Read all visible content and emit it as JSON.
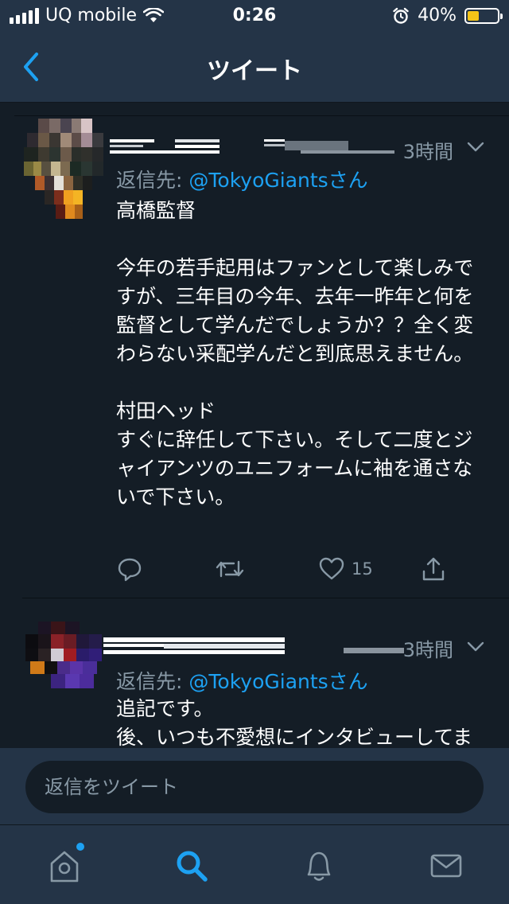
{
  "status_bar": {
    "carrier": "UQ mobile",
    "time": "0:26",
    "battery_percent": "40%",
    "battery_level": 0.4,
    "battery_color": "#f5c518"
  },
  "nav": {
    "title": "ツイート",
    "back_icon": "chevron-left-icon"
  },
  "colors": {
    "background": "#141d26",
    "bar_background": "#243447",
    "accent": "#1da1f2",
    "secondary_text": "#8899a6"
  },
  "tweets": [
    {
      "time": "3時間",
      "reply_prefix": "返信先: ",
      "mention": "@TokyoGiantsさん",
      "body": "高橋監督\n\n今年の若手起用はファンとして楽しみですが、三年目の今年、去年一昨年と何を監督として学んだでしょうか？？全く変わらない采配学んだと到底思えません。\n\n村田ヘッド\nすぐに辞任して下さい。そして二度とジャイアンツのユニフォームに袖を通さないで下さい。",
      "like_count": "15"
    },
    {
      "time": "3時間",
      "reply_prefix": "返信先: ",
      "mention": "@TokyoGiantsさん",
      "body": "追記です。\n後、いつも不愛想にインタビューしてますが選手より自らを律してくだ"
    }
  ],
  "composer": {
    "placeholder": "返信をツイート"
  },
  "tab_bar": {
    "items": [
      "home-icon",
      "search-icon",
      "notifications-icon",
      "messages-icon"
    ],
    "active": "search-icon"
  }
}
